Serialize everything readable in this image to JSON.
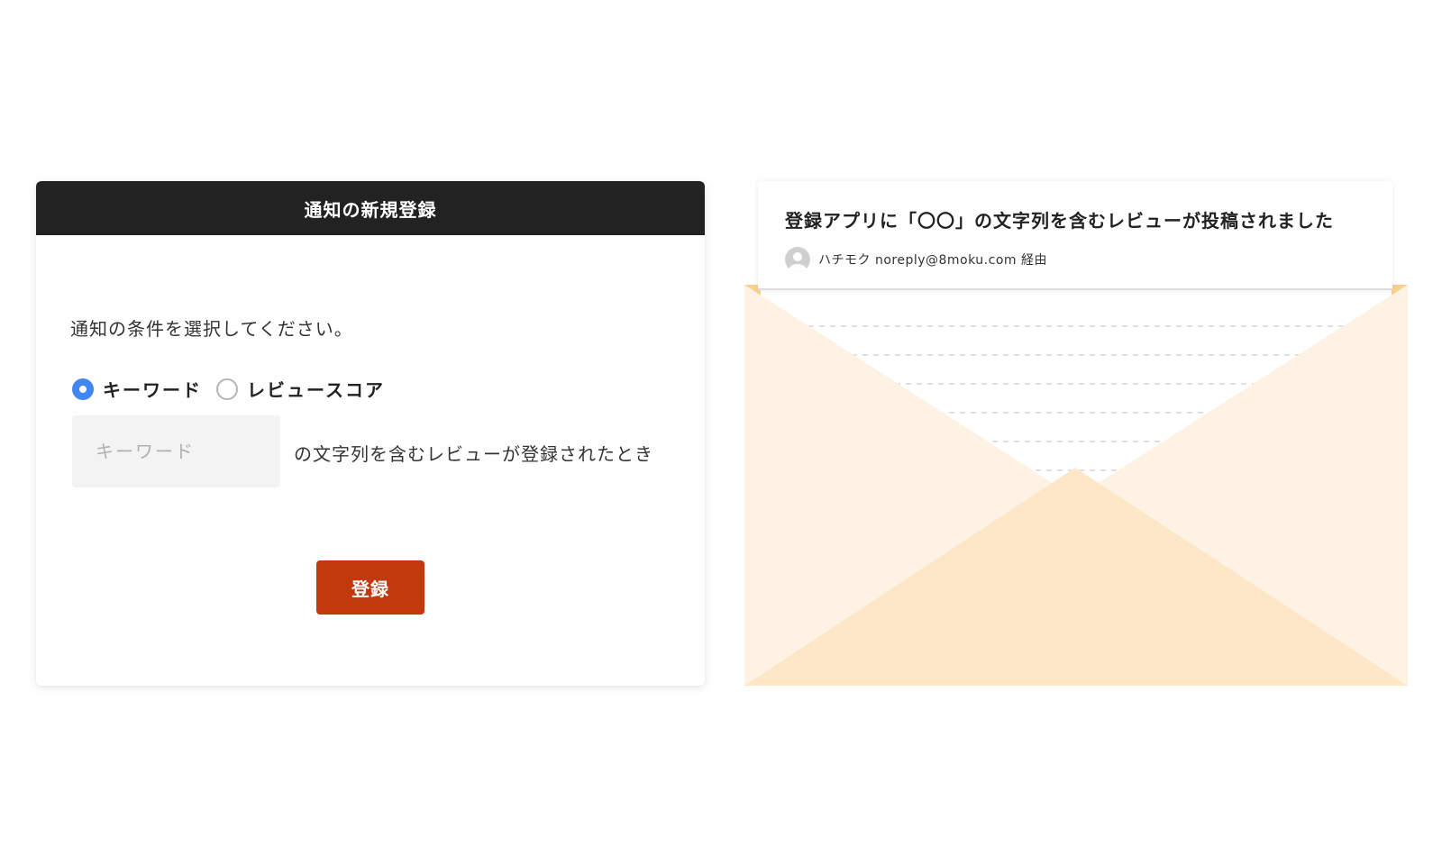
{
  "registration_card": {
    "title": "通知の新規登録",
    "instruction": "通知の条件を選択してください。",
    "options": [
      {
        "label": "キーワード",
        "selected": true
      },
      {
        "label": "レビュースコア",
        "selected": false
      }
    ],
    "keyword_input": {
      "placeholder": "キーワード",
      "value": ""
    },
    "condition_suffix": "の文字列を含むレビューが登録されたとき",
    "submit_label": "登録",
    "colors": {
      "header_bg": "#222222",
      "radio_selected": "#4285f4",
      "submit_bg": "#c1390d"
    }
  },
  "email_preview": {
    "subject": "登録アプリに「〇〇」の文字列を含むレビューが投稿されました",
    "sender": "ハチモク noreply@8moku.com 経由",
    "avatar_icon": "user-avatar-icon",
    "colors": {
      "envelope_light": "#fdf2e3",
      "envelope_front": "#fde7c7",
      "envelope_corner": "#f8d18f"
    }
  }
}
